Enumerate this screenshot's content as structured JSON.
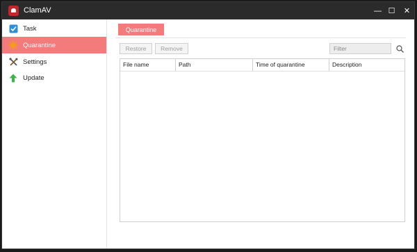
{
  "window": {
    "title": "ClamAV"
  },
  "titlebar_buttons": {
    "minimize": "—",
    "maximize": "☐",
    "close": "✕"
  },
  "sidebar": {
    "items": [
      {
        "label": "Task",
        "icon": "checkbox-icon",
        "active": false
      },
      {
        "label": "Quarantine",
        "icon": "virus-icon",
        "active": true
      },
      {
        "label": "Settings",
        "icon": "tools-icon",
        "active": false
      },
      {
        "label": "Update",
        "icon": "arrow-up-icon",
        "active": false
      }
    ]
  },
  "main": {
    "tab_label": "Quarantine",
    "restore_label": "Restore",
    "remove_label": "Remove",
    "filter_placeholder": "Filter",
    "columns": [
      "File name",
      "Path",
      "Time of quarantine",
      "Description"
    ]
  },
  "colors": {
    "accent": "#f47b7b",
    "titlebar": "#2b2b2b"
  }
}
